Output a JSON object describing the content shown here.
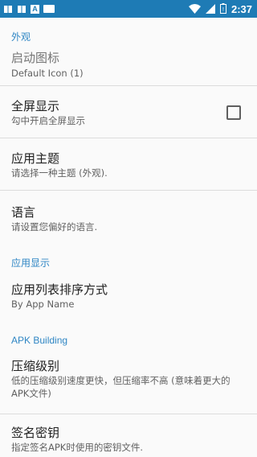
{
  "status_bar": {
    "time": "2:37",
    "notification_icons": [
      "book-icon",
      "book-icon",
      "a-icon",
      "card-icon"
    ],
    "system_icons": [
      "wifi-icon",
      "signal-icon",
      "battery-icon"
    ]
  },
  "settings": {
    "appearance_header": "外观",
    "launch_icon": {
      "title": "启动图标",
      "summary": "Default Icon (1)"
    },
    "fullscreen": {
      "title": "全屏显示",
      "summary": "勾中开启全屏显示",
      "checked": false
    },
    "app_theme": {
      "title": "应用主题",
      "summary": "请选择一种主题 (外观)."
    },
    "language": {
      "title": "语言",
      "summary": "请设置您偏好的语言."
    },
    "app_display_header": "应用显示",
    "app_list_sort": {
      "title": "应用列表排序方式",
      "summary": "By App Name"
    },
    "apk_building_header": "APK Building",
    "compression_level": {
      "title": "压缩级别",
      "summary": "低的压缩级别速度更快，但压缩率不高 (意味着更大的APK文件)"
    },
    "signing_key": {
      "title": "签名密钥",
      "summary": "指定签名APK时使用的密钥文件."
    }
  }
}
